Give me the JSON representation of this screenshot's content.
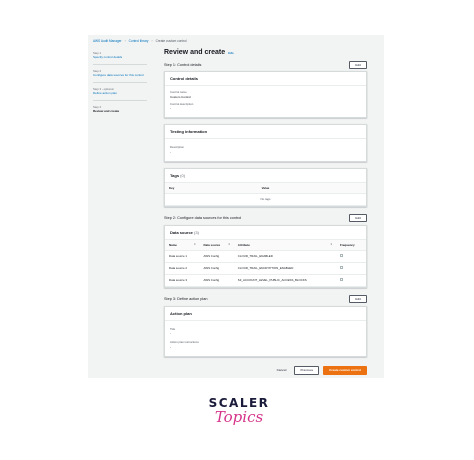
{
  "breadcrumb": [
    "AWS Audit Manager",
    "Control library",
    "Create custom control"
  ],
  "wizard": {
    "steps": [
      {
        "num": "Step 1",
        "label": "Specify control details"
      },
      {
        "num": "Step 2",
        "label": "Configure data sources for this control"
      },
      {
        "num": "Step 3 - optional",
        "label": "Define action plan"
      },
      {
        "num": "Step 4",
        "label": "Review and create"
      }
    ]
  },
  "page": {
    "title": "Review and create",
    "info": "Info"
  },
  "step1": {
    "heading": "Step 1: Control details",
    "edit": "Edit",
    "control_details": {
      "title": "Control details",
      "fields": [
        {
          "label": "Control name",
          "value": "Custom Control"
        },
        {
          "label": "Control description",
          "value": "-"
        }
      ]
    },
    "testing": {
      "title": "Testing information",
      "fields": [
        {
          "label": "Description",
          "value": "-"
        }
      ]
    },
    "tags": {
      "title": "Tags",
      "count": "(0)",
      "columns": [
        "Key",
        "Value"
      ],
      "empty": "No tags"
    }
  },
  "step2": {
    "heading": "Step 2: Configure data sources for this control",
    "edit": "Edit",
    "data_source": {
      "title": "Data source",
      "count": "(3)",
      "columns": [
        "Name",
        "Data source",
        "Attribute",
        "Frequency"
      ],
      "rows": [
        {
          "name": "Data source 1",
          "source": "AWS Config",
          "attribute": "CLOUD_TRAIL_ENABLED"
        },
        {
          "name": "Data source 2",
          "source": "AWS Config",
          "attribute": "CLOUD_TRAIL_ENCRYPTION_ENABLED"
        },
        {
          "name": "Data source 3",
          "source": "AWS Config",
          "attribute": "S3_ACCOUNT_LEVEL_PUBLIC_ACCESS_BLOCKS"
        }
      ]
    }
  },
  "step3": {
    "heading": "Step 3: Define action plan",
    "edit": "Edit",
    "action_plan": {
      "title": "Action plan",
      "fields": [
        {
          "label": "Title",
          "value": "-"
        },
        {
          "label": "Action plan instructions",
          "value": "-"
        }
      ]
    }
  },
  "footer": {
    "cancel": "Cancel",
    "previous": "Previous",
    "create": "Create custom control"
  },
  "logo": {
    "line1": "SCALER",
    "line2": "Topics"
  },
  "colors": {
    "link": "#0073bb",
    "primary": "#ec7211",
    "background": "#f2f3f3"
  }
}
